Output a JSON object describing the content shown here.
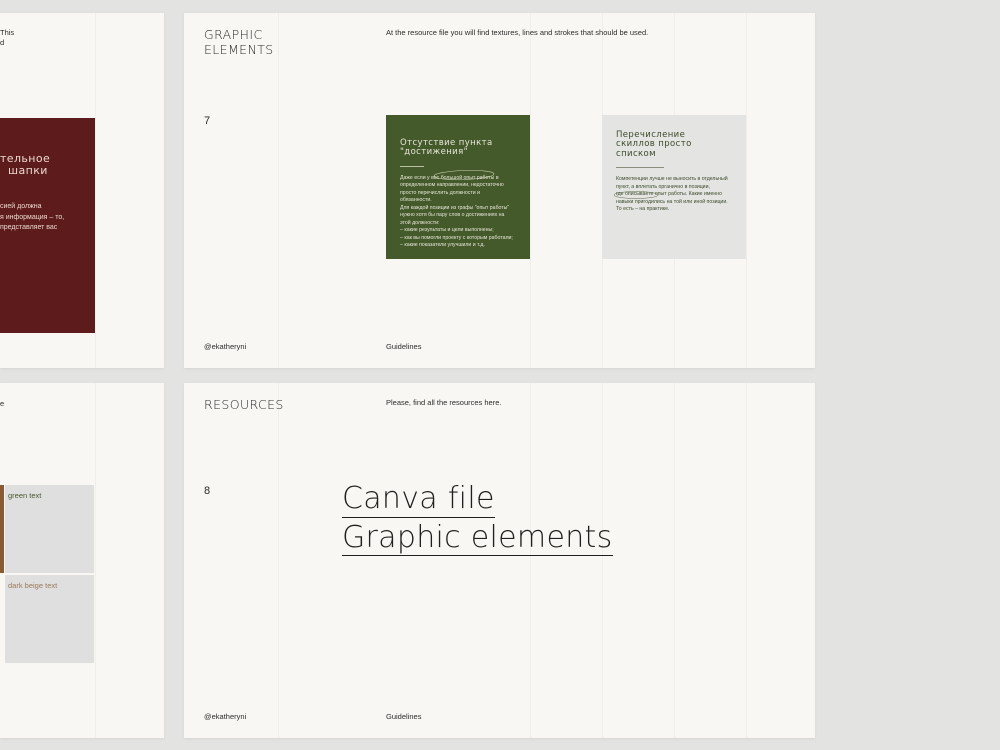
{
  "left_top_page": {
    "intro_fragment": [
      "This",
      "d"
    ],
    "card": {
      "heading": [
        "тельное",
        "шапки"
      ],
      "body": [
        "сией должна",
        "я информация – то,",
        "представляет вас"
      ],
      "bg": "#5e1b1b",
      "text_color": "#e9d9d0"
    }
  },
  "left_bottom_page": {
    "intro_fragment": "e",
    "swatches": [
      {
        "label": "green text",
        "bg": "#dfdfdf",
        "color": "#4a5a2e"
      },
      {
        "label": "dark beige text",
        "bg": "#dfdfdf",
        "color": "#9a7a5a"
      }
    ],
    "side_bar_color": "#8a5a32"
  },
  "page7": {
    "title": [
      "GRAPHIC",
      "ELEMENTS"
    ],
    "intro": "At the resource file you will find textures, lines and strokes that should be used.",
    "number": "7",
    "footer_handle": "@ekatheryni",
    "footer_label": "Guidelines",
    "green_card": {
      "heading": [
        "Отсутствие пункта",
        "\"достижения\""
      ],
      "body": [
        "Даже если у вас большой опыт работы в",
        "определенном направлении, недостаточно",
        "просто перечислить должности и",
        "обязанности.",
        "Для каждой позиции из графы \"опыт работы\"",
        "нужно хотя бы пару слов о достижениях на",
        "этой должности:",
        "– какие результаты и цели выполнены;",
        "– как вы помогли проекту с которым работали;",
        "– какие показатели улучшили и т.д."
      ],
      "bg": "#445a2a",
      "text_color": "#e8e6da"
    },
    "grey_card": {
      "heading": [
        "Перечисление",
        "скиллов просто",
        "списком"
      ],
      "body": [
        "Компетенции лучше не выносить в отдельный",
        "пункт, а вплетать органично в позиции,",
        "где описываете опыт работы. Какие именно",
        "навыки пригодились на той или иной позиции.",
        "То есть – на практике."
      ],
      "bg": "#e4e4e2",
      "text_color": "#3b4a2a"
    }
  },
  "page8": {
    "title": "RESOURCES",
    "intro": "Please, find all the resources here.",
    "number": "8",
    "links": [
      "Canva file",
      "Graphic elements"
    ],
    "footer_handle": "@ekatheryni",
    "footer_label": "Guidelines"
  }
}
